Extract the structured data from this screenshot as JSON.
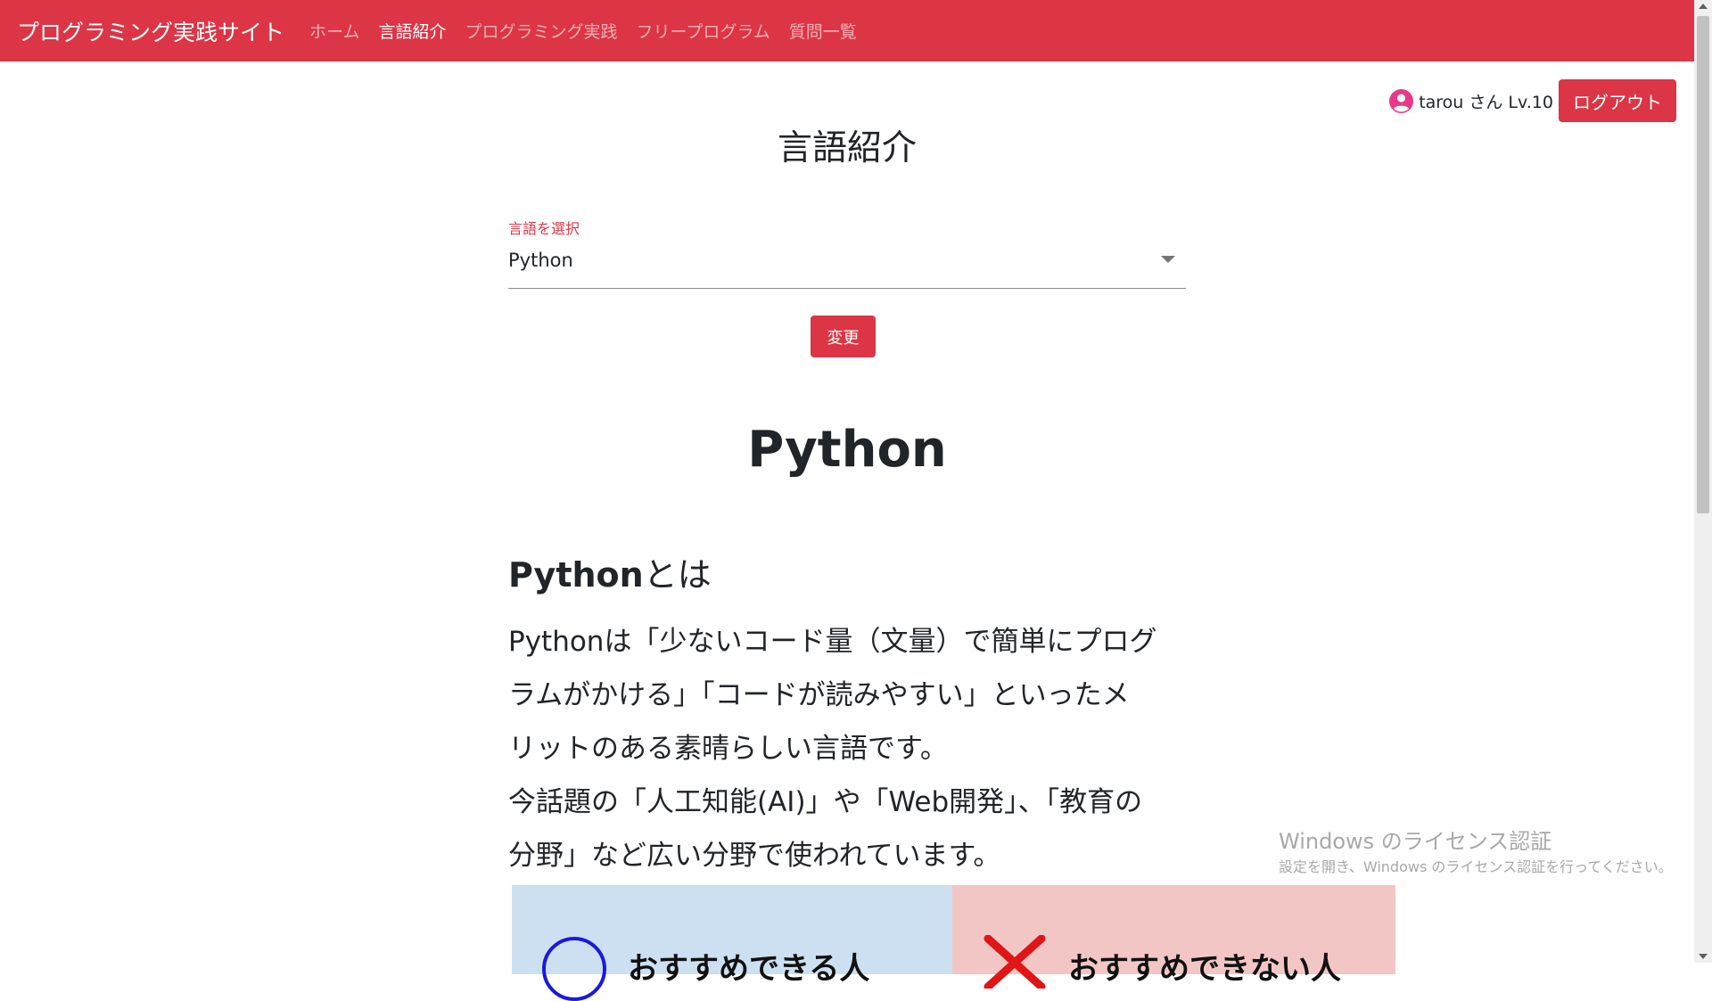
{
  "navbar": {
    "brand": "プログラミング実践サイト",
    "links": [
      {
        "label": "ホーム",
        "active": false
      },
      {
        "label": "言語紹介",
        "active": true
      },
      {
        "label": "プログラミング実践",
        "active": false
      },
      {
        "label": "フリープログラム",
        "active": false
      },
      {
        "label": "質問一覧",
        "active": false
      }
    ],
    "color": "#dc3545"
  },
  "user": {
    "text": "tarou さん Lv.10",
    "icon": "user-circle-icon",
    "icon_color": "#e8388a",
    "logout_label": "ログアウト"
  },
  "page": {
    "title": "言語紹介",
    "select_label": "言語を選択",
    "select_value": "Python",
    "change_label": "変更"
  },
  "content": {
    "lang_title": "Python",
    "heading_bold": "Python",
    "heading_rest": "とは",
    "para_line1": "Pythonは「少ないコード量（文量）で簡単にプログ",
    "para_line2": "ラムがかける」「コードが読みやすい」といったメ",
    "para_line3": "リットのある素晴らしい言語です。",
    "para_line4": "今話題の「人工知能(AI)」や「Web開発」、「教育の",
    "para_line5": "分野」など広い分野で使われています。",
    "compare": {
      "left_label": "おすすめできる人",
      "right_label": "おすすめできない人",
      "left_icon": "circle-icon",
      "right_icon": "cross-icon"
    }
  },
  "watermark": {
    "title": "Windows のライセンス認証",
    "subtitle": "設定を開き、Windows のライセンス認証を行ってください。"
  }
}
